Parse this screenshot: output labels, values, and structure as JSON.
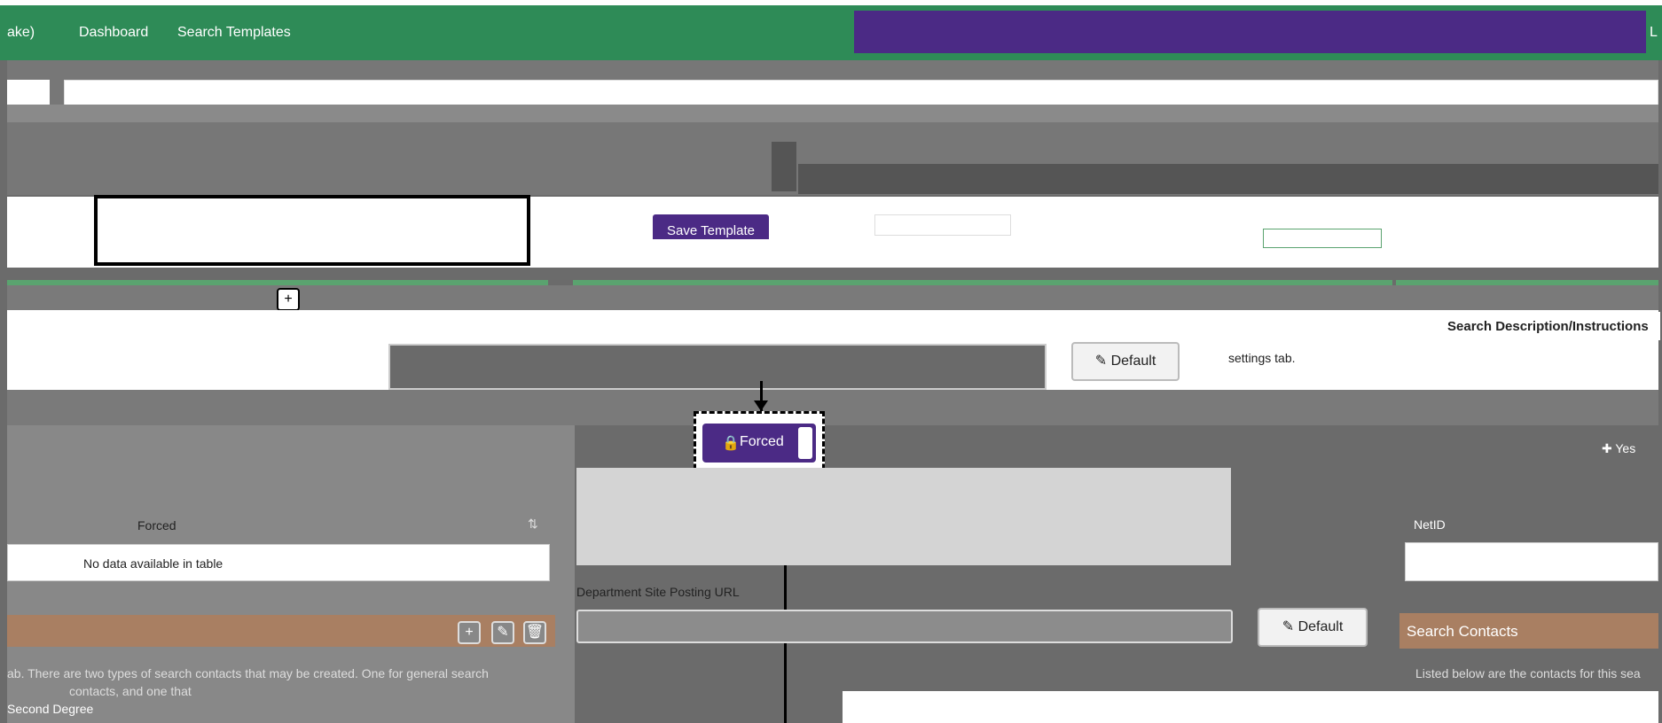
{
  "nav": {
    "brand_fragment": "ake)",
    "items": [
      "Dashboard",
      "Search Templates"
    ],
    "right_fragment": "L"
  },
  "toolbar": {
    "save_template_label": "Save Template"
  },
  "side": {
    "search_description_title": "Search Description/Instructions",
    "settings_tab_text": "settings tab."
  },
  "fields": {
    "default_label": "Default",
    "forced_label": "Forced",
    "department_site_posting_url_label": "Department Site Posting URL",
    "yes_label": "Yes"
  },
  "table": {
    "forced_header": "Forced",
    "empty_text": "No data available in table",
    "netid_header": "NetID"
  },
  "contacts": {
    "title": "Search Contacts",
    "listed_below_text": "Listed below are the contacts for this sea",
    "types_text": "ab. There are two types of search contacts that may be created. One for general search",
    "types_text_2": "contacts, and one that"
  },
  "degree": {
    "second_degree_label": "Second Degree"
  },
  "colors": {
    "nav_green": "#2e8b57",
    "accent_purple": "#4b2a85",
    "contacts_brown": "#a97f62"
  }
}
